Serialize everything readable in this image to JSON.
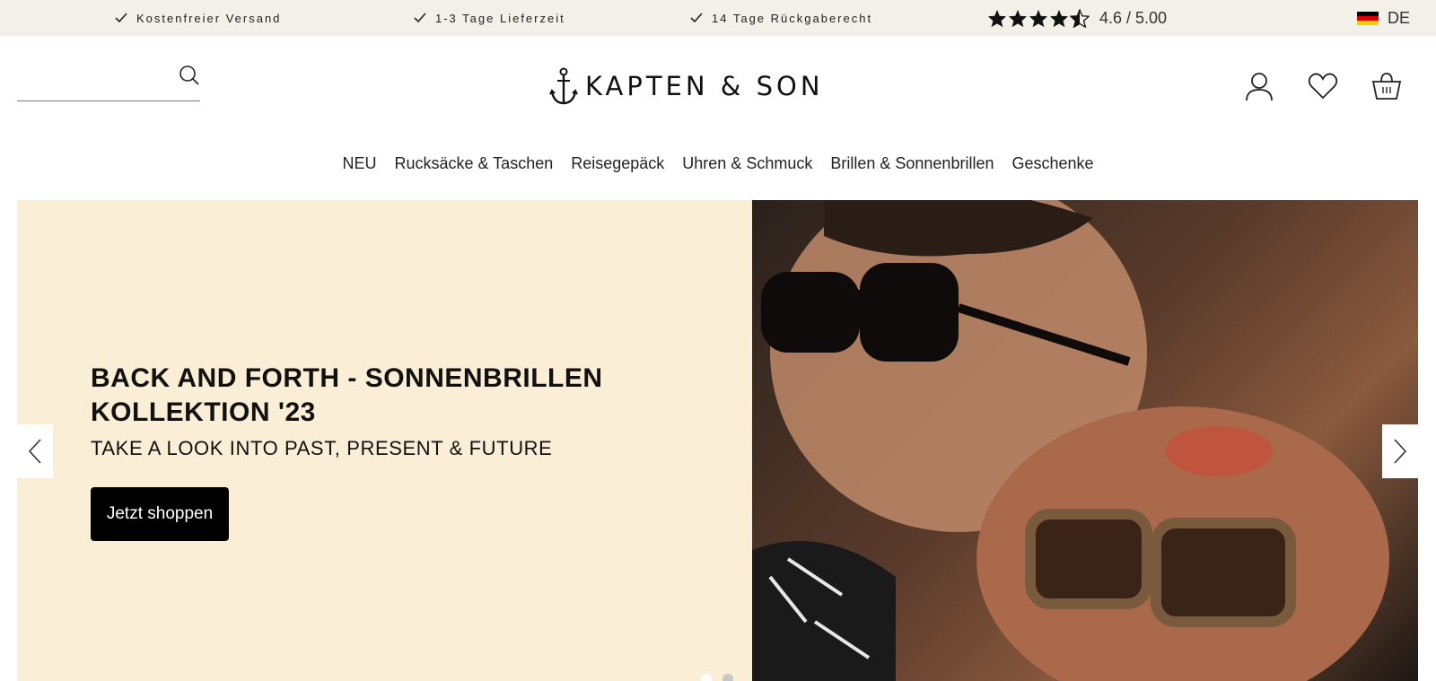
{
  "topbar": {
    "usps": [
      {
        "label": "Kostenfreier Versand",
        "icon": "check-icon"
      },
      {
        "label": "1-3 Tage Lieferzeit",
        "icon": "check-icon"
      },
      {
        "label": "14 Tage Rückgaberecht",
        "icon": "check-icon"
      }
    ],
    "rating": {
      "value": 4.6,
      "max": 5,
      "text": "4.6 / 5.00"
    },
    "language": {
      "label": "DE",
      "flag": "german-flag-icon"
    }
  },
  "header": {
    "search": {
      "placeholder": "",
      "value": "",
      "icon": "search-icon"
    },
    "logo": {
      "text": "KAPTEN & SON",
      "icon": "anchor-icon"
    },
    "actions": [
      {
        "name": "account",
        "icon": "user-icon"
      },
      {
        "name": "wishlist",
        "icon": "heart-icon"
      },
      {
        "name": "cart",
        "icon": "basket-icon"
      }
    ]
  },
  "nav": {
    "items": [
      {
        "label": "NEU"
      },
      {
        "label": "Rucksäcke & Taschen"
      },
      {
        "label": "Reisegepäck"
      },
      {
        "label": "Uhren & Schmuck"
      },
      {
        "label": "Brillen & Sonnenbrillen"
      },
      {
        "label": "Geschenke"
      }
    ]
  },
  "hero": {
    "title": "BACK AND FORTH - SONNENBRILLEN KOLLEKTION '23",
    "subtitle": "TAKE A LOOK INTO PAST, PRESENT & FUTURE",
    "cta": "Jetzt shoppen",
    "slides": {
      "count": 2,
      "active": 1
    }
  },
  "colors": {
    "topbar_bg": "#f3efe9",
    "hero_bg": "#faefd6",
    "cta_bg": "#000000",
    "text": "#111111"
  }
}
